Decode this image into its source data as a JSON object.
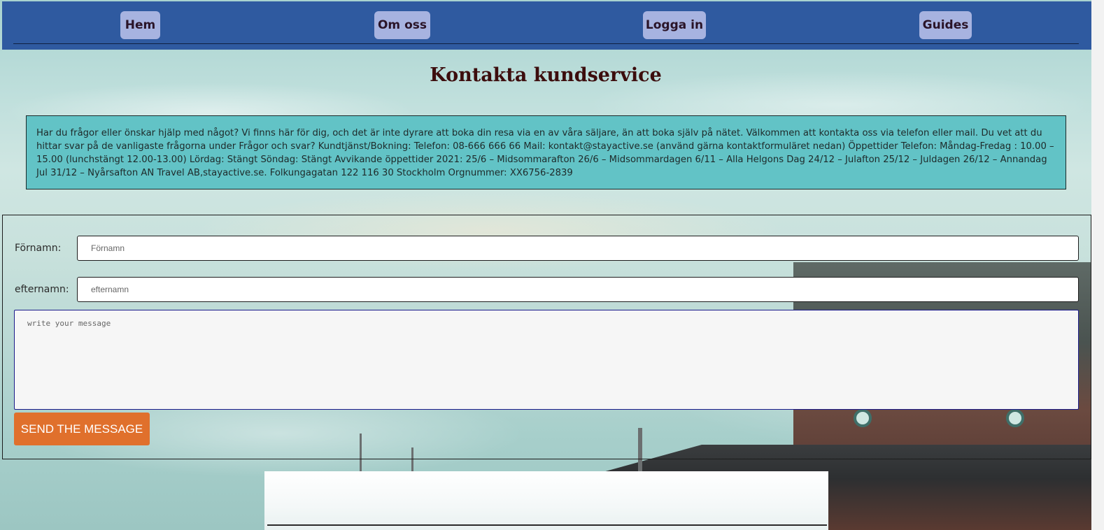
{
  "nav": {
    "items": [
      {
        "label": "Hem"
      },
      {
        "label": "Om oss"
      },
      {
        "label": "Logga in"
      },
      {
        "label": "Guides"
      }
    ]
  },
  "page": {
    "title": "Kontakta kundservice"
  },
  "info": {
    "text": "Har du frågor eller önskar hjälp med något? Vi finns här för dig, och det är inte dyrare att boka din resa via en av våra säljare, än att boka själv på nätet. Välkommen att kontakta oss via telefon eller mail. Du vet att du hittar svar på de vanligaste frågorna under Frågor och svar? Kundtjänst/Bokning: Telefon: 08-666 666 66 Mail: kontakt@stayactive.se (använd gärna kontaktformuläret nedan) Öppettider Telefon: Måndag-Fredag : 10.00 – 15.00 (lunchstängt 12.00-13.00) Lördag: Stängt Söndag: Stängt Avvikande öppettider 2021: 25/6 – Midsommarafton 26/6 – Midsommardagen 6/11 – Alla Helgons Dag 24/12 – Julafton 25/12 – Juldagen 26/12 – Annandag Jul 31/12 – Nyårsafton AN Travel AB,stayactive.se. Folkungagatan 122 116 30 Stockholm Orgnummer: XX6756-2839"
  },
  "form": {
    "firstname_label": "Förnamn:",
    "firstname_placeholder": "Förnamn",
    "lastname_label": "efternamn:",
    "lastname_placeholder": "efternamn",
    "message_placeholder": "write your message",
    "send_label": "SEND THE MESSAGE"
  },
  "colors": {
    "header_bg": "#2f5aa0",
    "nav_button_bg": "#a7b3e0",
    "info_box_bg": "#62c3c6",
    "send_button_bg": "#e0702c",
    "title_color": "#3c0d0d"
  }
}
